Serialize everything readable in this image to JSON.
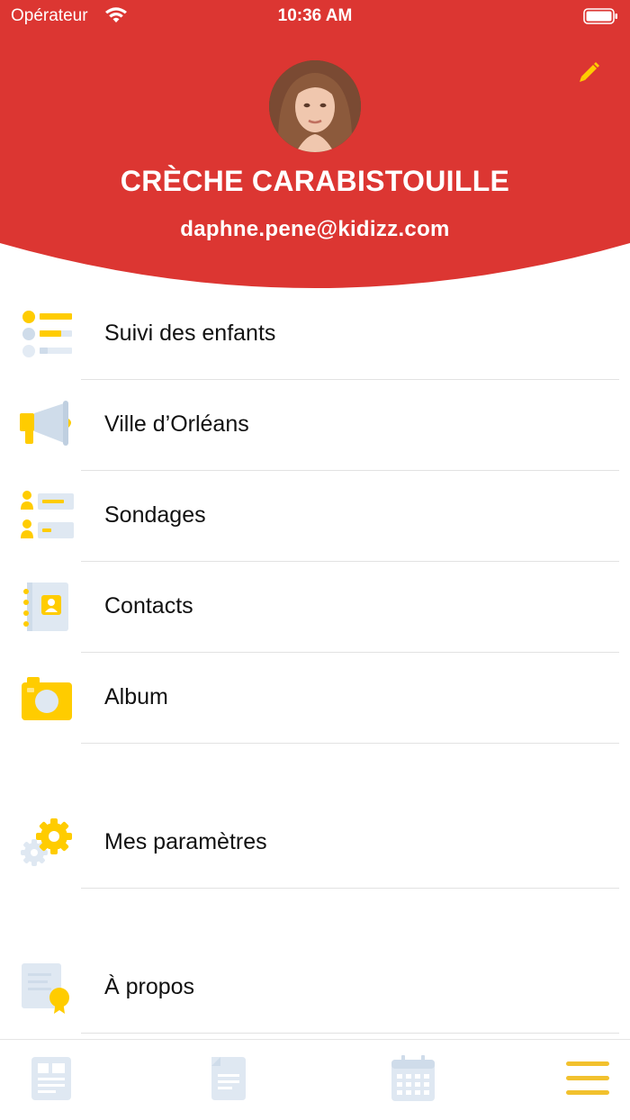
{
  "status_bar": {
    "carrier": "Opérateur",
    "time": "10:36 AM"
  },
  "header": {
    "org_name": "CRÈCHE CARABISTOUILLE",
    "email": "daphne.pene@kidizz.com",
    "edit_icon": "pencil-icon",
    "brand_color": "#dc3632",
    "accent_color": "#ffcc00"
  },
  "menu": {
    "items": [
      {
        "label": "Suivi des enfants",
        "icon": "child-tracking-icon"
      },
      {
        "label": "Ville d’Orléans",
        "icon": "megaphone-icon"
      },
      {
        "label": "Sondages",
        "icon": "poll-icon"
      },
      {
        "label": "Contacts",
        "icon": "contacts-book-icon"
      },
      {
        "label": "Album",
        "icon": "camera-icon"
      },
      {
        "label": "Mes paramètres",
        "icon": "settings-gears-icon"
      },
      {
        "label": "À propos",
        "icon": "certificate-icon"
      }
    ]
  },
  "tabbar": {
    "tabs": [
      {
        "icon": "news-feed-icon",
        "active": false
      },
      {
        "icon": "document-icon",
        "active": false
      },
      {
        "icon": "calendar-icon",
        "active": false
      },
      {
        "icon": "hamburger-menu-icon",
        "active": true
      }
    ]
  }
}
